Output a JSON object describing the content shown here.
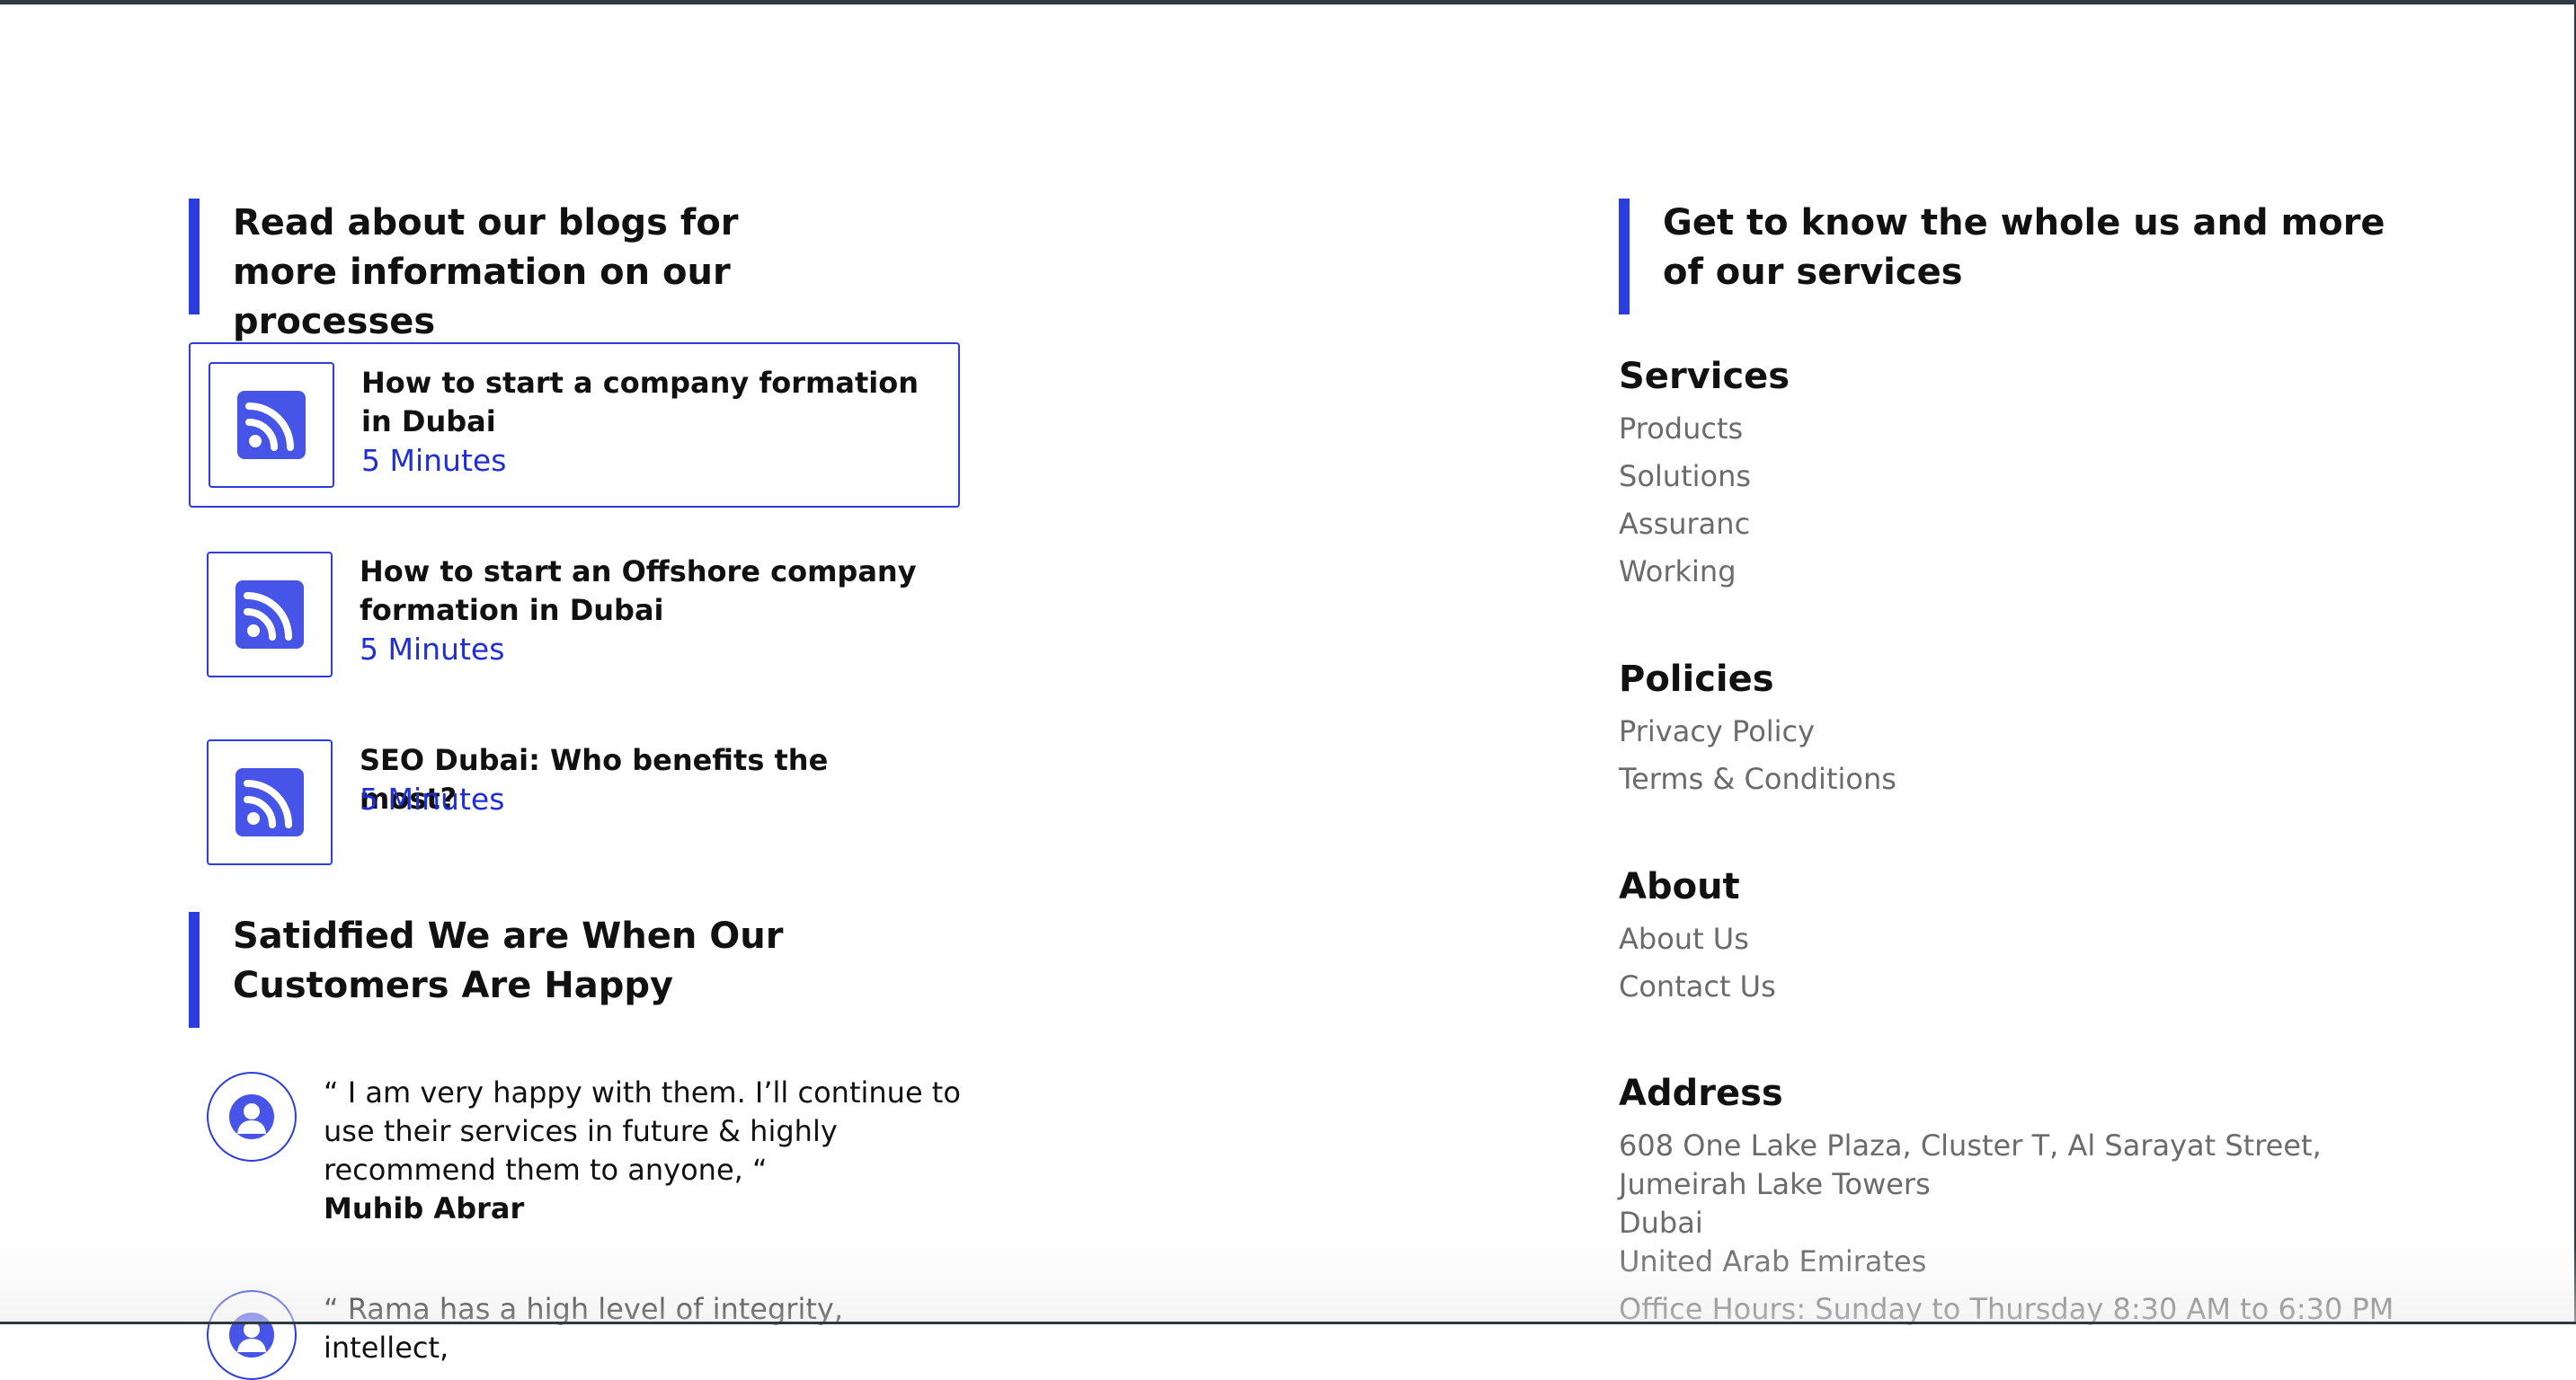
{
  "blogs_section": {
    "title": "Read about our blogs for more information on our processes",
    "items": [
      {
        "title": "How to start a company formation in Dubai",
        "meta": "5 Minutes",
        "icon": "rss-icon"
      },
      {
        "title": "How to start an Offshore company formation in Dubai",
        "meta": "5 Minutes",
        "icon": "rss-icon"
      },
      {
        "title": "SEO Dubai: Who benefits the most?",
        "meta": "5 Minutes",
        "icon": "rss-icon"
      }
    ]
  },
  "testimonials_section": {
    "title": "Satidfied We are When Our Customers Are Happy",
    "items": [
      {
        "quote": "“ I am very happy with them. I’ll continue to use their services in future & highly recommend them to anyone, “",
        "author": "Muhib Abrar",
        "icon": "user-avatar-icon"
      },
      {
        "quote": "“ Rama has a high level of integrity, intellect,",
        "author": "",
        "icon": "user-avatar-icon"
      }
    ]
  },
  "about_section": {
    "title": "Get to know the whole us and more of our services"
  },
  "services": {
    "heading": "Services",
    "links": [
      "Products",
      "Solutions",
      "Assuranc",
      "Working"
    ]
  },
  "policies": {
    "heading": "Policies",
    "links": [
      "Privacy Policy",
      "Terms & Conditions"
    ]
  },
  "about": {
    "heading": "About",
    "links": [
      "About Us",
      "Contact Us"
    ]
  },
  "address": {
    "heading": "Address",
    "street": "608 One Lake Plaza, Cluster T, Al Sarayat Street, Jumeirah Lake Towers",
    "city": "Dubai",
    "country": "United Arab Emirates",
    "office_hours": "Office Hours: Sunday to Thursday 8:30 AM to 6:30 PM"
  },
  "colors": {
    "accent": "#2c3de0",
    "icon_fill": "#4654e8",
    "link_gray": "#6b6b6b",
    "meta_blue": "#1f2fd8"
  }
}
